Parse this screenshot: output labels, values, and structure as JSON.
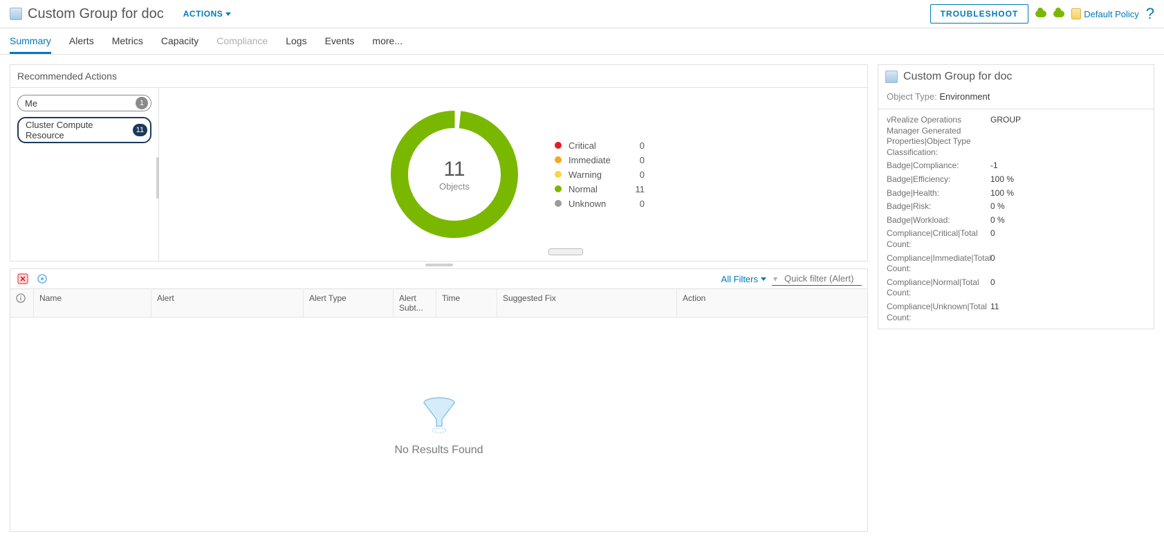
{
  "header": {
    "title": "Custom Group for doc",
    "actions_label": "ACTIONS",
    "troubleshoot_label": "TROUBLESHOOT",
    "policy_label": "Default Policy"
  },
  "tabs": [
    "Summary",
    "Alerts",
    "Metrics",
    "Capacity",
    "Compliance",
    "Logs",
    "Events",
    "more..."
  ],
  "active_tab": 0,
  "disabled_tab": 4,
  "recommended": {
    "title": "Recommended Actions",
    "pills": [
      {
        "label": "Me",
        "count": "1",
        "active": false
      },
      {
        "label": "Cluster Compute Resource",
        "count": "11",
        "active": true
      }
    ]
  },
  "chart_data": {
    "type": "pie",
    "title": "",
    "center_value": "11",
    "center_label": "Objects",
    "series": [
      {
        "name": "Critical",
        "value": 0,
        "color": "#e02020"
      },
      {
        "name": "Immediate",
        "value": 0,
        "color": "#f5a623"
      },
      {
        "name": "Warning",
        "value": 0,
        "color": "#f8d648"
      },
      {
        "name": "Normal",
        "value": 11,
        "color": "#7ab800"
      },
      {
        "name": "Unknown",
        "value": 0,
        "color": "#9b9b9b"
      }
    ]
  },
  "filters": {
    "all_filters_label": "All Filters",
    "quick_filter_placeholder": "Quick filter (Alert)"
  },
  "table": {
    "columns": [
      "",
      "Name",
      "Alert",
      "Alert Type",
      "Alert Subt...",
      "Time",
      "Suggested Fix",
      "Action"
    ],
    "col_widths": [
      "34px",
      "170px",
      "220px",
      "130px",
      "62px",
      "88px",
      "260px",
      "auto"
    ],
    "empty_message": "No Results Found"
  },
  "side": {
    "title": "Custom Group for doc",
    "object_type_label": "Object Type:",
    "object_type_value": "Environment",
    "props": [
      {
        "label": "vRealize Operations Manager Generated Properties|Object Type Classification:",
        "value": "GROUP"
      },
      {
        "label": "Badge|Compliance:",
        "value": "-1"
      },
      {
        "label": "Badge|Efficiency:",
        "value": "100 %"
      },
      {
        "label": "Badge|Health:",
        "value": "100 %"
      },
      {
        "label": "Badge|Risk:",
        "value": "0 %"
      },
      {
        "label": "Badge|Workload:",
        "value": "0 %"
      },
      {
        "label": "Compliance|Critical|Total Count:",
        "value": "0"
      },
      {
        "label": "Compliance|Immediate|Total Count:",
        "value": "0"
      },
      {
        "label": "Compliance|Normal|Total Count:",
        "value": "0"
      },
      {
        "label": "Compliance|Unknown|Total Count:",
        "value": "11"
      }
    ]
  }
}
